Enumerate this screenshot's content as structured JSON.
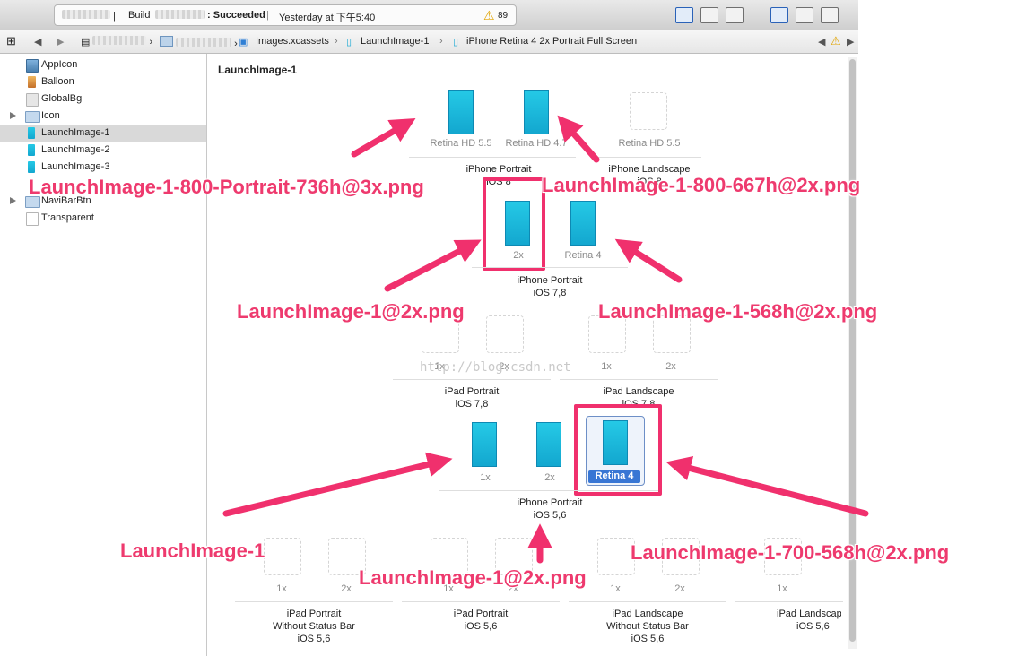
{
  "toolbar": {
    "build_label": "Build",
    "status_text": "Succeeded",
    "timestamp": "Yesterday at 下午5:40",
    "warning_count": "89"
  },
  "jumpbar": {
    "crumb_assets": "Images.xcassets",
    "crumb_set": "LaunchImage-1",
    "crumb_slot": "iPhone Retina 4 2x Portrait Full Screen"
  },
  "sidebar": {
    "items": [
      {
        "label": "AppIcon"
      },
      {
        "label": "Balloon"
      },
      {
        "label": "GlobalBg"
      },
      {
        "label": "Icon"
      },
      {
        "label": "LaunchImage-1"
      },
      {
        "label": "LaunchImage-2"
      },
      {
        "label": "LaunchImage-3"
      },
      {
        "label": "NaviBarBtn"
      },
      {
        "label": "Transparent"
      }
    ]
  },
  "main": {
    "set_title": "LaunchImage-1",
    "slots": {
      "retina_hd_55": "Retina HD 5.5",
      "retina_hd_47": "Retina HD 4.7",
      "retina_hd_55_land": "Retina HD 5.5",
      "two_x": "2x",
      "retina_4": "Retina 4",
      "one_x": "1x",
      "retina_4_selected": "Retina 4"
    },
    "groups": {
      "iphone_portrait_ios8": {
        "name": "iPhone Portrait",
        "os": "iOS 8"
      },
      "iphone_landscape_ios8": {
        "name": "iPhone Landscape",
        "os": "iOS 8"
      },
      "iphone_portrait_ios78": {
        "name": "iPhone Portrait",
        "os": "iOS 7,8"
      },
      "ipad_portrait_ios78": {
        "name": "iPad Portrait",
        "os": "iOS 7,8"
      },
      "ipad_landscape_ios78": {
        "name": "iPad Landscape",
        "os": "iOS 7,8"
      },
      "iphone_portrait_ios56": {
        "name": "iPhone Portrait",
        "os": "iOS 5,6"
      },
      "ipad_portrait_nsb_ios56": {
        "name": "iPad Portrait",
        "sub": "Without Status Bar",
        "os": "iOS 5,6"
      },
      "ipad_portrait_ios56": {
        "name": "iPad Portrait",
        "os": "iOS 5,6"
      },
      "ipad_landscape_nsb_ios56": {
        "name": "iPad Landscape",
        "sub": "Without Status Bar",
        "os": "iOS 5,6"
      },
      "ipad_landscape_ios56": {
        "name": "iPad Landscape",
        "os": "iOS 5,6"
      }
    }
  },
  "annotations": {
    "a1": "LaunchImage-1-800-Portrait-736h@3x.png",
    "a2": "LaunchImage-1-800-667h@2x.png",
    "a3": "LaunchImage-1@2x.png",
    "a4": "LaunchImage-1-568h@2x.png",
    "a5": "LaunchImage-1",
    "a6": "LaunchImage-1@2x.png",
    "a7": "LaunchImage-1-700-568h@2x.png"
  },
  "watermark": "http://blog.csdn.net",
  "colors": {
    "annotation": "#ee3a6e",
    "selection": "#3876d4",
    "launch_image": "#1fb8de"
  }
}
